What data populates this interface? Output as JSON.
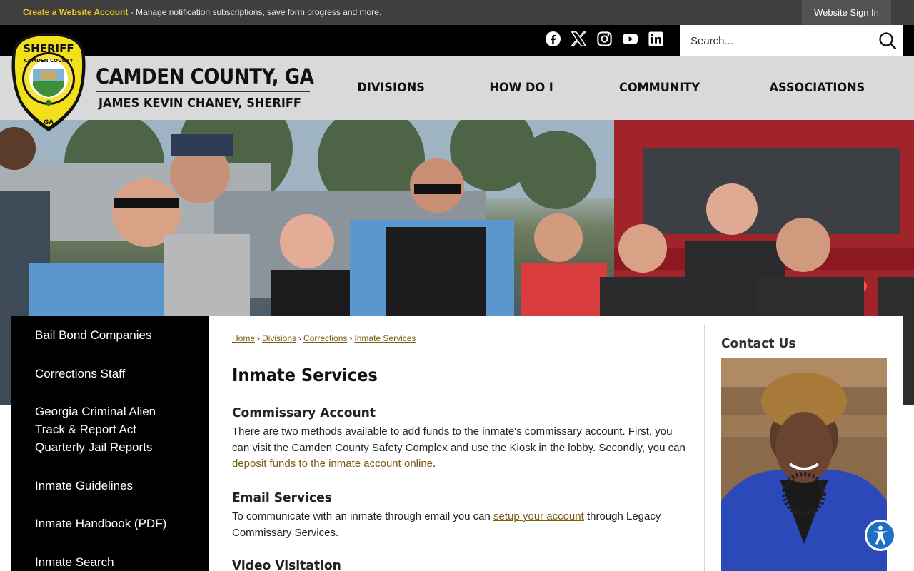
{
  "topbar": {
    "create_link": "Create a Website Account",
    "message": " - Manage notification subscriptions, save form progress and more.",
    "signin": "Website Sign In"
  },
  "social": [
    "facebook-icon",
    "x-twitter-icon",
    "instagram-icon",
    "youtube-icon",
    "linkedin-icon"
  ],
  "search": {
    "placeholder": "Search..."
  },
  "brand": {
    "badge_top": "SHERIFF",
    "badge_ring": "CAMDEN COUNTY",
    "badge_bottom": "GA",
    "title": "CAMDEN COUNTY, GA",
    "subtitle": "JAMES KEVIN CHANEY, SHERIFF"
  },
  "nav": [
    "DIVISIONS",
    "HOW DO I",
    "COMMUNITY",
    "ASSOCIATIONS"
  ],
  "sidenav": {
    "items": [
      "Bail Bond Companies",
      "Corrections Staff",
      "Georgia Criminal Alien Track & Report Act Quarterly Jail Reports",
      "Inmate Guidelines",
      "Inmate Handbook (PDF)",
      "Inmate Search"
    ]
  },
  "breadcrumb": [
    "Home",
    "Divisions",
    "Corrections",
    "Inmate Services"
  ],
  "page": {
    "title": "Inmate Services",
    "sections": [
      {
        "heading": "Commissary Account",
        "text_before": "There are two methods available to add funds to the inmate's commissary account. First, you can visit the Camden County Safety Complex and use the Kiosk in the lobby. Secondly, you can ",
        "link": "deposit funds to the inmate account online",
        "text_after": "."
      },
      {
        "heading": "Email Services",
        "text_before": "To communicate with an inmate through email you can ",
        "link": "setup your account",
        "text_after": " through Legacy Commissary Services."
      },
      {
        "heading": "Video Visitation"
      }
    ]
  },
  "contact": {
    "title": "Contact Us"
  },
  "colors": {
    "accent_yellow": "#f2c81f",
    "link": "#7a5d10",
    "header_gray": "#d9d9d9"
  }
}
